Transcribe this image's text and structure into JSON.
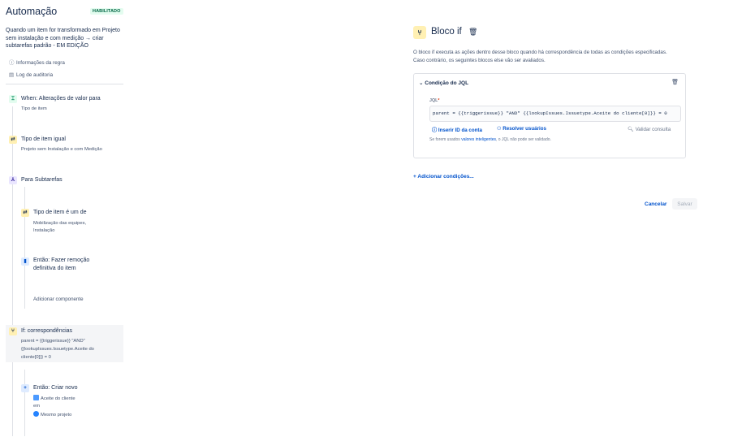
{
  "header": {
    "title": "Automação",
    "status_badge": "HABILITADO"
  },
  "rule_name": "Quando um item for transformado em Projeto sem instalação e com medição → criar subtarefas padrão - EM EDIÇÃO",
  "meta": {
    "rule_details": "Informações da regra",
    "audit_log": "Log de auditoria"
  },
  "components": {
    "trigger": {
      "title": "When: Alterações de valor para",
      "subtitle": "Tipo de item"
    },
    "condition1": {
      "title": "Tipo de item igual",
      "subtitle": "Projeto sem Instalação e com Medição"
    },
    "branch": {
      "title": "Para Subtarefas"
    },
    "condition2": {
      "title": "Tipo de item é um de",
      "subtitle_1": "Mobilização das equipes,",
      "subtitle_2": "Instalação"
    },
    "action_delete": {
      "title_1": "Então: Fazer remoção",
      "title_2": "definitiva do item"
    },
    "add_component": "Adicionar componente",
    "if_block": {
      "title": "If: correspondências",
      "line_1": "parent = {{triggerissue}} \"AND\"",
      "line_2": "{{lookupIssues.Issuetype.Aceite do",
      "line_3": "cliente[0]}} = 0"
    },
    "action_create": {
      "title": "Então: Criar novo",
      "type": "Aceite do cliente",
      "in": "em",
      "project": "Mesmo projeto"
    }
  },
  "panel": {
    "title": "Bloco if",
    "description_1": "O bloco if executa as ações dentro desse bloco quando há correspondência de todas as condições especificadas.",
    "description_2": "Caso contrário, os seguintes blocos else vão ser avaliados.",
    "condition": {
      "header": "Condição do JQL",
      "jql_label": "JQL",
      "jql_value": "parent = {{triggerissue}} \"AND\" {{lookupIssues.Issuetype.Aceite do cliente[0]}} = 0",
      "insert_account": "Inserir ID da conta",
      "resolve_users": "Resolver usuários",
      "validate_query": "Validar consulta",
      "hint_before": "Se forem usados ",
      "hint_link": "valores inteligentes",
      "hint_after": ", o JQL não pode ser validado."
    },
    "add_conditions": "Adicionar condições...",
    "cancel": "Cancelar",
    "save": "Salvar"
  },
  "colors": {
    "link": "#0052cc",
    "enabled_bg": "#e3fcef",
    "enabled_text": "#006644",
    "condition_icon_bg": "#fff0b3"
  },
  "icons": [
    "info-icon",
    "document-icon",
    "lightning-icon",
    "shuffle-icon",
    "branch-icon",
    "trash-icon",
    "condition-icon",
    "plus-icon",
    "globe-icon",
    "search-icon",
    "chevron-down-icon"
  ]
}
